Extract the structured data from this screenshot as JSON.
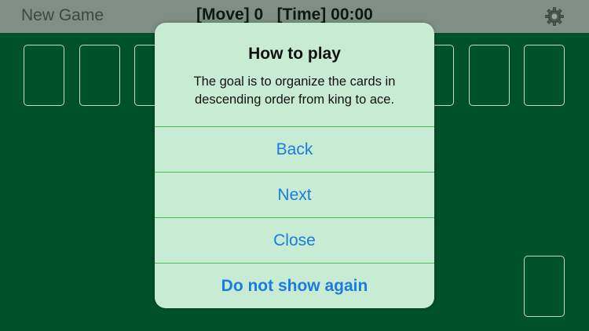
{
  "header": {
    "new_game_label": "New Game",
    "status": "[Move] 0   [Time] 00:00",
    "settings_icon": "gear-icon"
  },
  "dialog": {
    "title": "How to play",
    "line1": "The goal is to organize the cards in",
    "line2": "descending order from king to ace.",
    "buttons": {
      "back": "Back",
      "next": "Next",
      "close": "Close",
      "dont_show": "Do not show again"
    }
  },
  "colors": {
    "felt": "#00522a",
    "topbar": "#7f8f86",
    "dialog": "#c7ecd3",
    "button_text": "#1a7be0"
  }
}
